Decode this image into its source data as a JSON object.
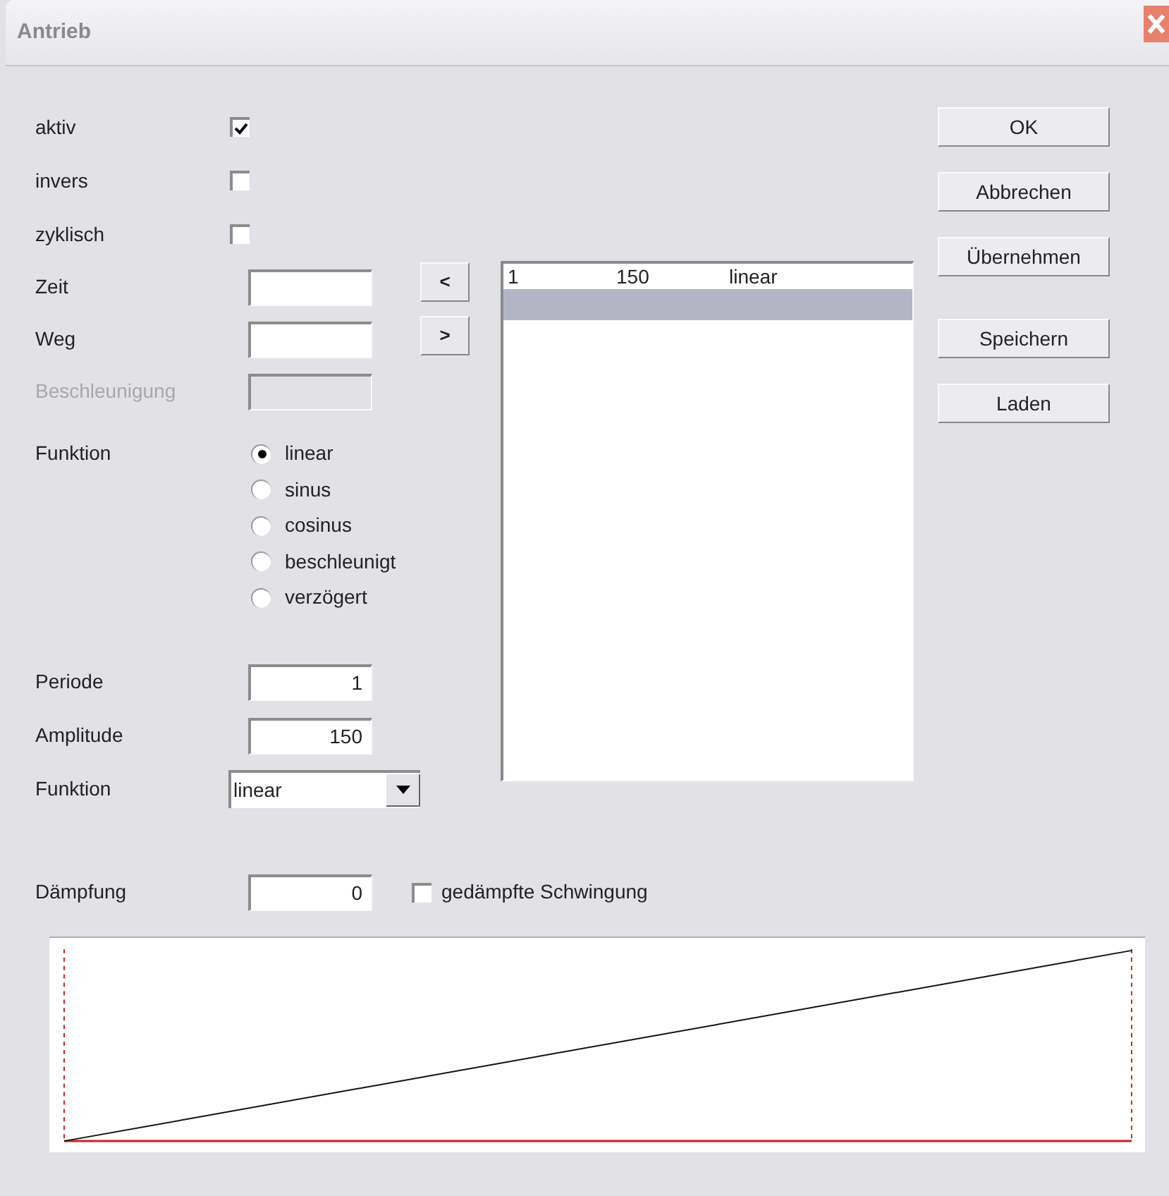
{
  "window": {
    "title": "Antrieb"
  },
  "options": [
    {
      "label": "aktiv",
      "checked": true
    },
    {
      "label": "invers",
      "checked": false
    },
    {
      "label": "zyklisch",
      "checked": false
    }
  ],
  "fields": [
    {
      "label": "Zeit",
      "disabled": false
    },
    {
      "label": "Weg",
      "disabled": false
    },
    {
      "label": "Beschleunigung",
      "disabled": true
    }
  ],
  "arrow_buttons": [
    "<",
    ">"
  ],
  "function_radios": {
    "label": "Funktion",
    "options": [
      {
        "label": "linear",
        "selected": true
      },
      {
        "label": "sinus",
        "selected": false
      },
      {
        "label": "cosinus",
        "selected": false
      },
      {
        "label": "beschleunigt",
        "selected": false
      },
      {
        "label": "verzögert",
        "selected": false
      }
    ]
  },
  "parameters": [
    {
      "label": "Periode",
      "value": "1"
    },
    {
      "label": "Amplitude",
      "value": "150"
    }
  ],
  "function_select": {
    "label": "Funktion",
    "value": "linear"
  },
  "list": {
    "rows": [
      {
        "cells": [
          "1",
          "150",
          "linear"
        ],
        "selected": false
      },
      {
        "selected": true
      }
    ]
  },
  "button_groups": [
    [
      "OK",
      "Abbrechen",
      "Übernehmen"
    ],
    [
      "Speichern",
      "Laden"
    ]
  ],
  "damping": {
    "label": "Dämpfung",
    "value": "0",
    "checkbox": {
      "label": "gedämpfte Schwingung",
      "checked": false
    }
  }
}
